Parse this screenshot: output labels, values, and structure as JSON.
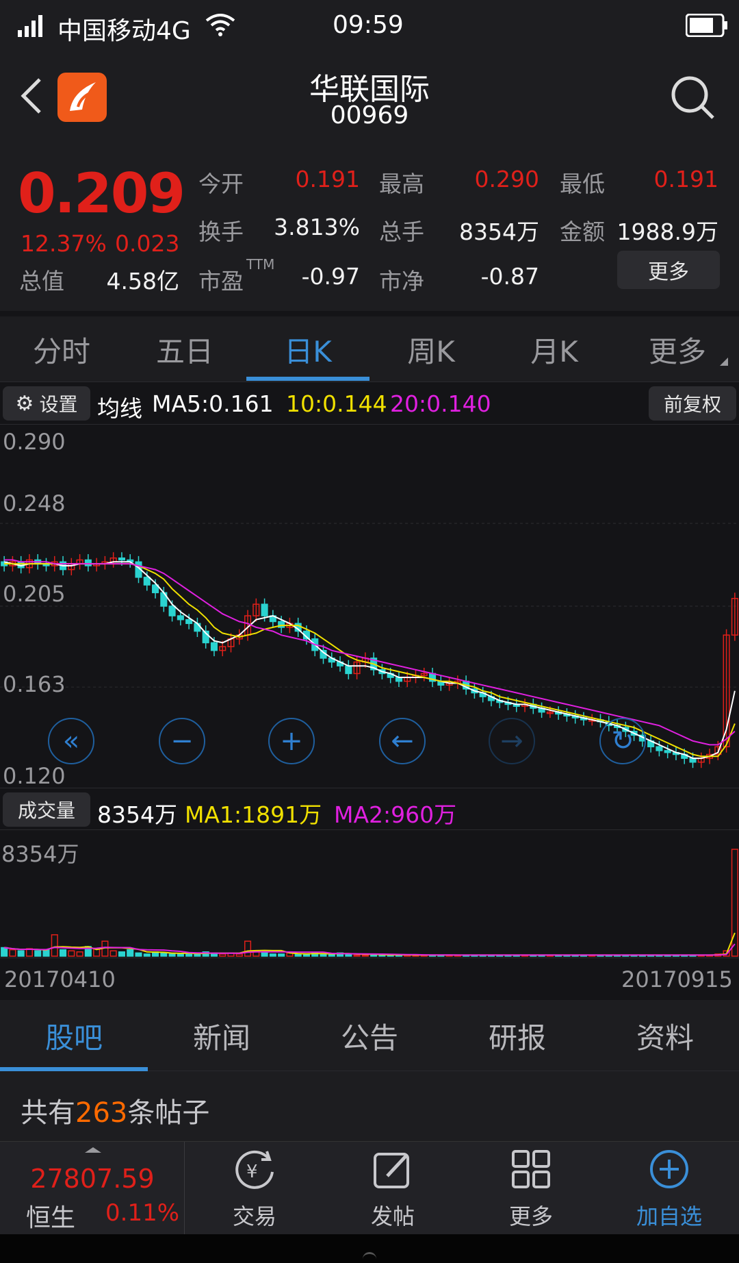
{
  "status_bar": {
    "carrier": "中国移动4G",
    "time": "09:59"
  },
  "header": {
    "title": "华联国际",
    "code": "00969"
  },
  "quote": {
    "price": "0.209",
    "change_pct": "12.37%",
    "change": "0.023",
    "market_cap_label": "总值",
    "market_cap": "4.58亿",
    "stats": [
      {
        "label": "今开",
        "value": "0.191"
      },
      {
        "label": "最高",
        "value": "0.290"
      },
      {
        "label": "最低",
        "value": "0.191"
      },
      {
        "label": "换手",
        "value": "3.813%"
      },
      {
        "label": "总手",
        "value": "8354万"
      },
      {
        "label": "金额",
        "value": "1988.9万"
      },
      {
        "label": "市盈",
        "value": "-0.97"
      },
      {
        "label": "市净",
        "value": "-0.87"
      }
    ],
    "pe_suffix": "TTM",
    "more_label": "更多"
  },
  "chart_tabs": {
    "items": [
      "分时",
      "五日",
      "日K",
      "周K",
      "月K",
      "更多"
    ],
    "active": "日K"
  },
  "kline_bar": {
    "settings": "设置",
    "ma_prefix": "均线",
    "ma5": "MA5:0.161",
    "ma10": "10:0.144",
    "ma20": "20:0.140",
    "adjust": "前复权"
  },
  "volume_bar": {
    "label": "成交量",
    "volume": "8354万",
    "ma1": "MA1:1891万",
    "ma2": "MA2:960万",
    "max": "8354万"
  },
  "dates": {
    "start": "20170410",
    "end": "20170915"
  },
  "bottom_tabs": {
    "items": [
      "股吧",
      "新闻",
      "公告",
      "研报",
      "资料"
    ],
    "active": "股吧"
  },
  "posts": {
    "prefix": "共有",
    "count": "263",
    "suffix": "条帖子"
  },
  "index": {
    "value": "27807.59",
    "name": "恒生",
    "change": "0.11%"
  },
  "bottom_bar": {
    "items": [
      "交易",
      "发帖",
      "更多",
      "加自选"
    ]
  },
  "colors": {
    "up": "#e0201a",
    "down": "#2bd3d0",
    "accent": "#3a8fd8",
    "ma5": "#ffffff",
    "ma10": "#f0e000",
    "ma20": "#e020e0",
    "orange": "#ff6a00"
  },
  "chart_data": {
    "type": "candlestick",
    "title": "",
    "ylim": [
      0.12,
      0.29
    ],
    "y_ticks": [
      "0.290",
      "0.248",
      "0.205",
      "0.163",
      "0.120"
    ],
    "x_range": [
      "20170410",
      "20170915"
    ],
    "close": [
      0.226,
      0.228,
      0.225,
      0.229,
      0.227,
      0.226,
      0.228,
      0.224,
      0.227,
      0.229,
      0.226,
      0.227,
      0.228,
      0.23,
      0.229,
      0.228,
      0.22,
      0.216,
      0.212,
      0.205,
      0.2,
      0.198,
      0.196,
      0.192,
      0.186,
      0.182,
      0.184,
      0.188,
      0.19,
      0.2,
      0.206,
      0.2,
      0.197,
      0.194,
      0.196,
      0.192,
      0.188,
      0.182,
      0.178,
      0.176,
      0.174,
      0.17,
      0.176,
      0.178,
      0.172,
      0.17,
      0.168,
      0.166,
      0.168,
      0.169,
      0.17,
      0.166,
      0.164,
      0.165,
      0.166,
      0.162,
      0.16,
      0.158,
      0.156,
      0.155,
      0.154,
      0.153,
      0.154,
      0.152,
      0.15,
      0.15,
      0.149,
      0.148,
      0.147,
      0.146,
      0.146,
      0.145,
      0.143,
      0.142,
      0.14,
      0.138,
      0.135,
      0.132,
      0.13,
      0.129,
      0.128,
      0.126,
      0.124,
      0.126,
      0.128,
      0.132,
      0.19,
      0.209
    ],
    "ma5": [
      0.228,
      0.227,
      0.226,
      0.227,
      0.227,
      0.227,
      0.227,
      0.226,
      0.226,
      0.227,
      0.227,
      0.227,
      0.227,
      0.228,
      0.228,
      0.228,
      0.225,
      0.221,
      0.217,
      0.212,
      0.206,
      0.202,
      0.199,
      0.196,
      0.191,
      0.187,
      0.186,
      0.188,
      0.19,
      0.194,
      0.198,
      0.199,
      0.2,
      0.198,
      0.196,
      0.193,
      0.189,
      0.185,
      0.181,
      0.178,
      0.176,
      0.174,
      0.174,
      0.174,
      0.173,
      0.171,
      0.17,
      0.168,
      0.168,
      0.168,
      0.168,
      0.167,
      0.166,
      0.165,
      0.165,
      0.163,
      0.161,
      0.16,
      0.158,
      0.156,
      0.155,
      0.154,
      0.154,
      0.153,
      0.152,
      0.151,
      0.15,
      0.149,
      0.148,
      0.147,
      0.146,
      0.145,
      0.144,
      0.143,
      0.141,
      0.139,
      0.137,
      0.135,
      0.133,
      0.131,
      0.129,
      0.128,
      0.126,
      0.126,
      0.127,
      0.129,
      0.141,
      0.161
    ],
    "ma10": [
      0.227,
      0.227,
      0.227,
      0.227,
      0.227,
      0.227,
      0.227,
      0.227,
      0.227,
      0.227,
      0.227,
      0.227,
      0.227,
      0.227,
      0.227,
      0.227,
      0.226,
      0.224,
      0.222,
      0.219,
      0.214,
      0.21,
      0.206,
      0.203,
      0.199,
      0.194,
      0.191,
      0.19,
      0.189,
      0.19,
      0.191,
      0.193,
      0.194,
      0.195,
      0.195,
      0.195,
      0.193,
      0.191,
      0.188,
      0.185,
      0.182,
      0.179,
      0.177,
      0.176,
      0.175,
      0.173,
      0.172,
      0.171,
      0.17,
      0.169,
      0.168,
      0.167,
      0.166,
      0.166,
      0.165,
      0.164,
      0.163,
      0.161,
      0.16,
      0.158,
      0.157,
      0.156,
      0.155,
      0.154,
      0.153,
      0.152,
      0.151,
      0.15,
      0.149,
      0.148,
      0.147,
      0.146,
      0.145,
      0.144,
      0.143,
      0.142,
      0.14,
      0.138,
      0.136,
      0.134,
      0.132,
      0.13,
      0.128,
      0.127,
      0.127,
      0.127,
      0.133,
      0.144
    ],
    "ma20": [
      0.229,
      0.229,
      0.228,
      0.228,
      0.228,
      0.228,
      0.227,
      0.227,
      0.227,
      0.227,
      0.227,
      0.227,
      0.227,
      0.227,
      0.227,
      0.227,
      0.226,
      0.225,
      0.224,
      0.222,
      0.219,
      0.216,
      0.213,
      0.21,
      0.207,
      0.204,
      0.201,
      0.199,
      0.197,
      0.196,
      0.194,
      0.193,
      0.192,
      0.19,
      0.189,
      0.188,
      0.187,
      0.185,
      0.184,
      0.182,
      0.181,
      0.18,
      0.179,
      0.178,
      0.177,
      0.176,
      0.175,
      0.174,
      0.173,
      0.172,
      0.171,
      0.17,
      0.169,
      0.168,
      0.167,
      0.166,
      0.165,
      0.164,
      0.163,
      0.162,
      0.161,
      0.16,
      0.159,
      0.158,
      0.157,
      0.156,
      0.155,
      0.154,
      0.153,
      0.152,
      0.151,
      0.15,
      0.149,
      0.148,
      0.147,
      0.146,
      0.145,
      0.144,
      0.143,
      0.141,
      0.139,
      0.137,
      0.135,
      0.134,
      0.133,
      0.133,
      0.136,
      0.14
    ],
    "volume": [
      8,
      6,
      5,
      7,
      5,
      6,
      20,
      6,
      5,
      4,
      9,
      7,
      14,
      5,
      4,
      6,
      3,
      2,
      4,
      3,
      2,
      2,
      3,
      2,
      4,
      3,
      2,
      3,
      2,
      14,
      5,
      3,
      2,
      2,
      3,
      2,
      2,
      3,
      2,
      2,
      3,
      2,
      1,
      1,
      2,
      1,
      1,
      1,
      1,
      1,
      1,
      1,
      1,
      1,
      1,
      1,
      1,
      1,
      1,
      1,
      1,
      1,
      1,
      1,
      1,
      1,
      1,
      1,
      1,
      1,
      1,
      1,
      1,
      1,
      1,
      1,
      1,
      1,
      1,
      1,
      1,
      1,
      1,
      1,
      1,
      2,
      5,
      100
    ]
  }
}
